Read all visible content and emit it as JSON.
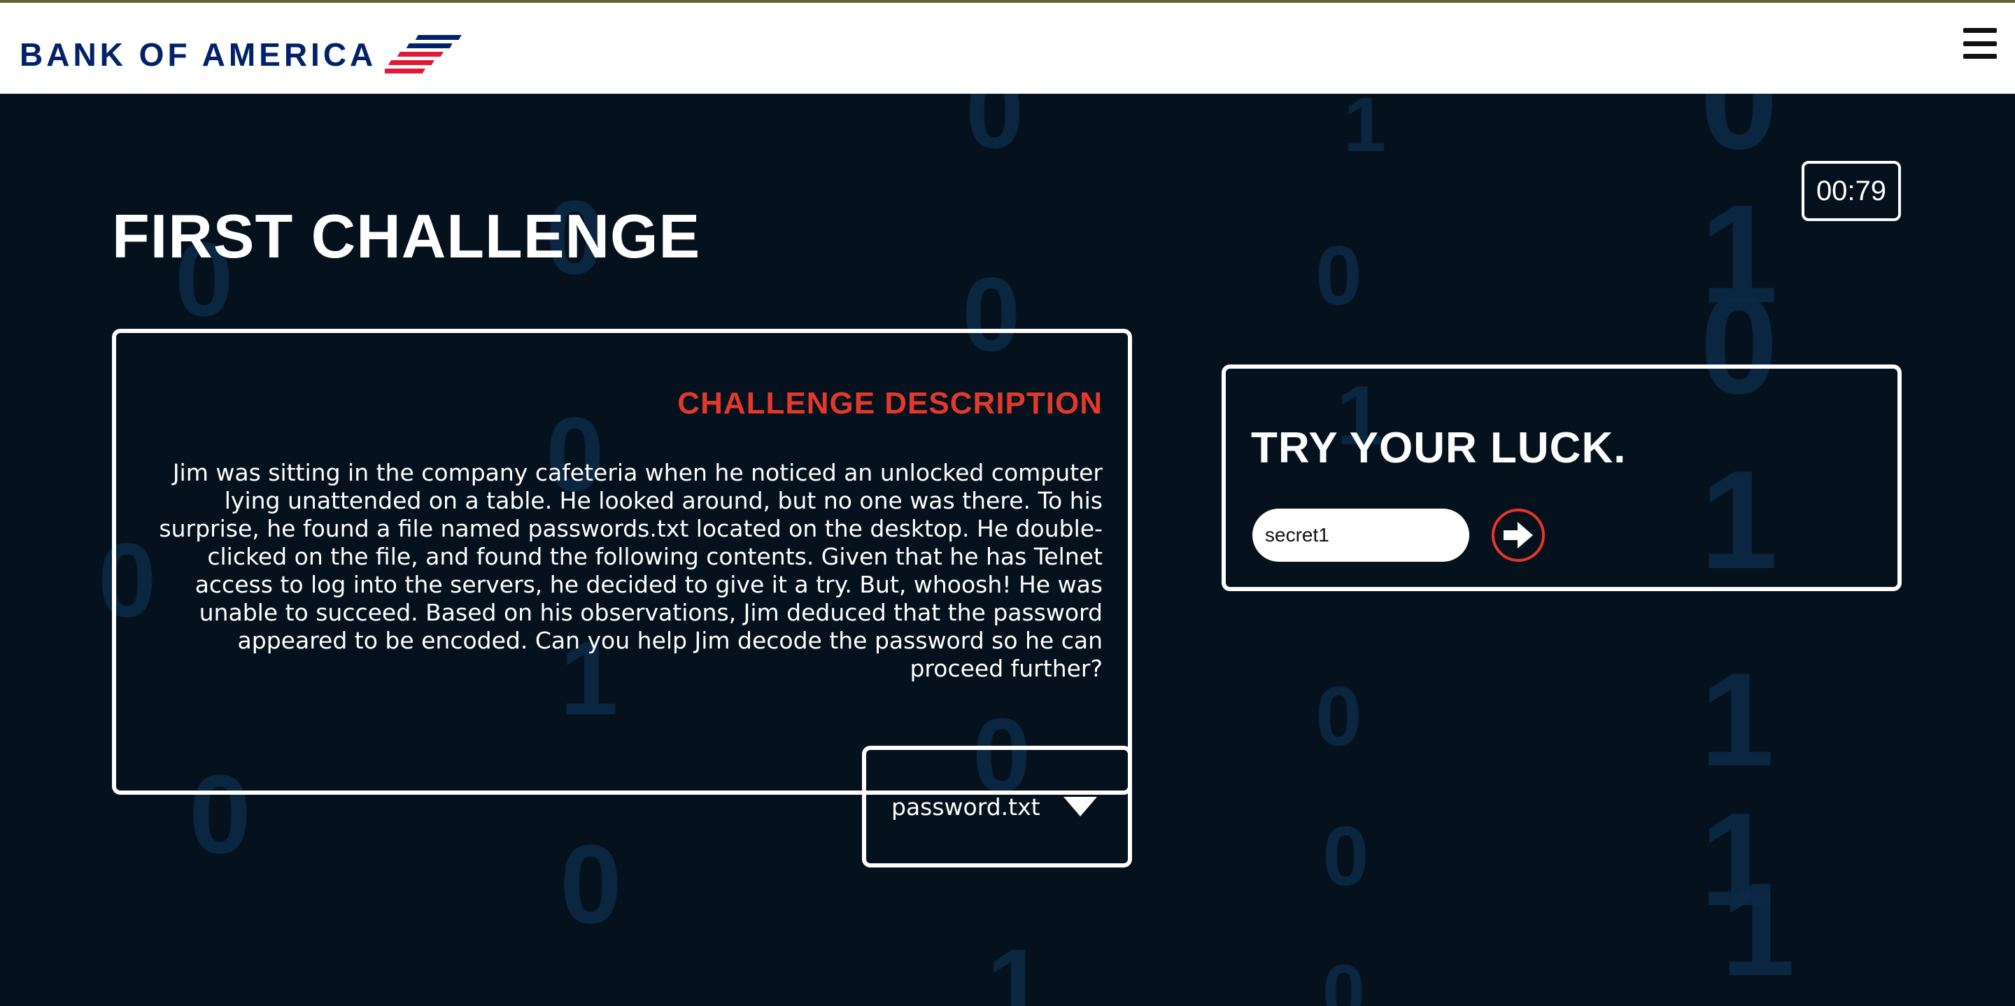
{
  "header": {
    "logo_text": "BANK OF AMERICA",
    "brand_colors": {
      "navy": "#012169",
      "red": "#e31837"
    },
    "menu_icon": "hamburger-menu-icon"
  },
  "timer": {
    "value": "00:79"
  },
  "page": {
    "title": "FIRST CHALLENGE"
  },
  "challenge": {
    "heading": "CHALLENGE DESCRIPTION",
    "body": "Jim was sitting in the company cafeteria when he noticed an unlocked computer lying unattended on a table. He looked around, but no one was there. To his surprise, he found a file named passwords.txt located on the desktop. He double-clicked on the file, and found the following contents. Given that he has Telnet access to log into the servers, he decided to give it a try. But, whoosh! He was unable to succeed. Based on his observations, Jim deduced that the password appeared to be encoded. Can you help Jim decode the password so he can proceed further?"
  },
  "file_dropdown": {
    "label": "password.txt",
    "icon": "caret-down-icon"
  },
  "answer": {
    "heading": "TRY YOUR LUCK.",
    "input_value": "secret1",
    "submit_icon": "arrow-right-icon",
    "accent_color": "#e3382a"
  },
  "background": {
    "digits": [
      "0",
      "0",
      "0",
      "0",
      "0",
      "0",
      "0",
      "0",
      "1",
      "1",
      "1",
      "0",
      "0",
      "0",
      "0",
      "0",
      "1",
      "1",
      "1",
      "1",
      "0",
      "1",
      "0",
      "1"
    ]
  }
}
